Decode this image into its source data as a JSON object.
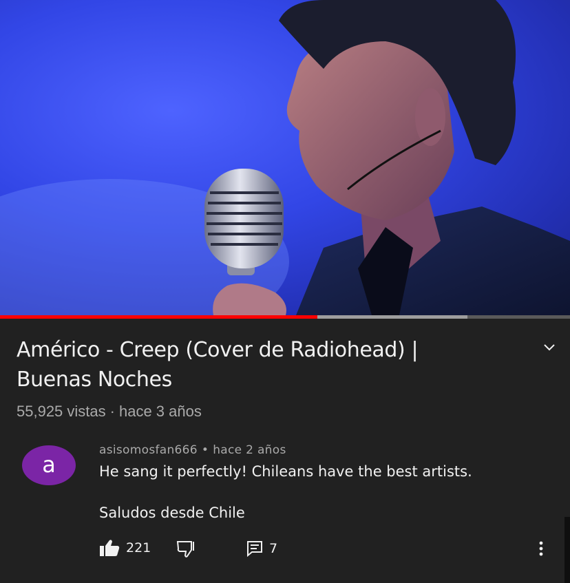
{
  "video": {
    "progress_played_fraction": 0.557,
    "progress_buffered_fraction": 0.82
  },
  "info": {
    "title": "Américo - Creep (Cover de Radiohead) | Buenas Noches",
    "views": "55,925 vistas",
    "separator": "·",
    "age": "hace 3 años",
    "expand_icon": "chevron-down-icon"
  },
  "comment": {
    "avatar_letter": "a",
    "avatar_color": "#7b25a6",
    "author": "asisomosfan666",
    "separator": "•",
    "age": "hace 2 años",
    "text_line1": "He sang it perfectly! Chileans have the best artists.",
    "text_line2": "Saludos desde Chile",
    "like_count": "221",
    "reply_count": "7",
    "icons": [
      "thumbs-up-icon",
      "thumbs-down-icon",
      "reply-icon",
      "more-vert-icon"
    ]
  },
  "colors": {
    "background": "#0f0f0f",
    "panel": "#212121",
    "progress_red": "#ff0000",
    "secondary_text": "#aaaaaa"
  }
}
